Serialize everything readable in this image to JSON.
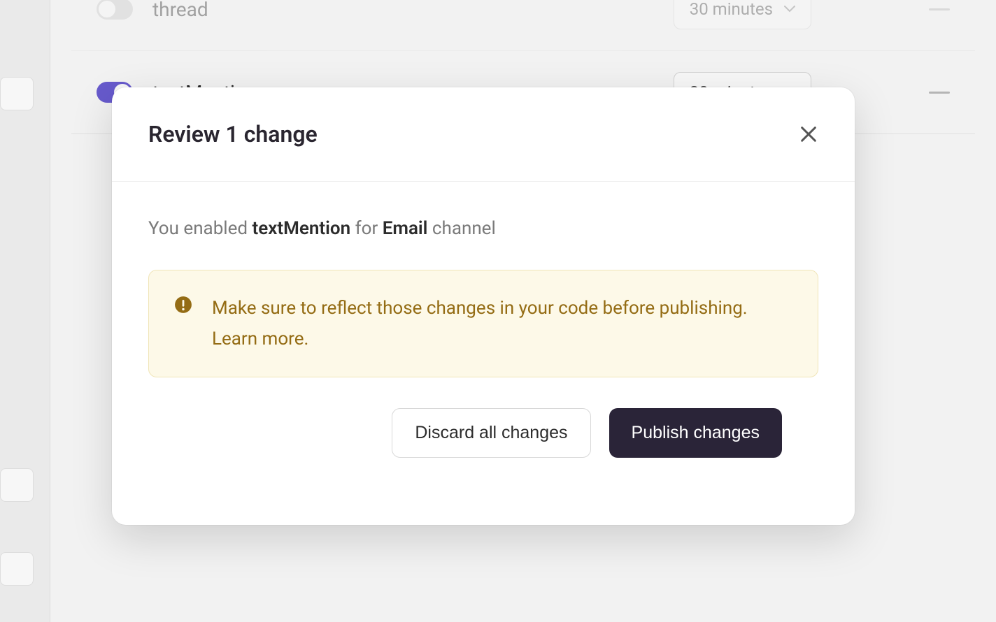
{
  "settings": {
    "rows": [
      {
        "label": "thread",
        "toggle": "off",
        "interval": "30 minutes"
      },
      {
        "label": "textMention",
        "toggle": "on",
        "interval": "30 minutes"
      }
    ]
  },
  "modal": {
    "title": "Review 1 change",
    "summary": {
      "prefix": "You enabled ",
      "kind": "textMention",
      "mid": " for ",
      "channel": "Email",
      "suffix": " channel"
    },
    "warning": {
      "text": "Make sure to reflect those changes in your code before publishing. ",
      "link": "Learn more."
    },
    "actions": {
      "discard": "Discard all changes",
      "publish": "Publish changes"
    }
  }
}
